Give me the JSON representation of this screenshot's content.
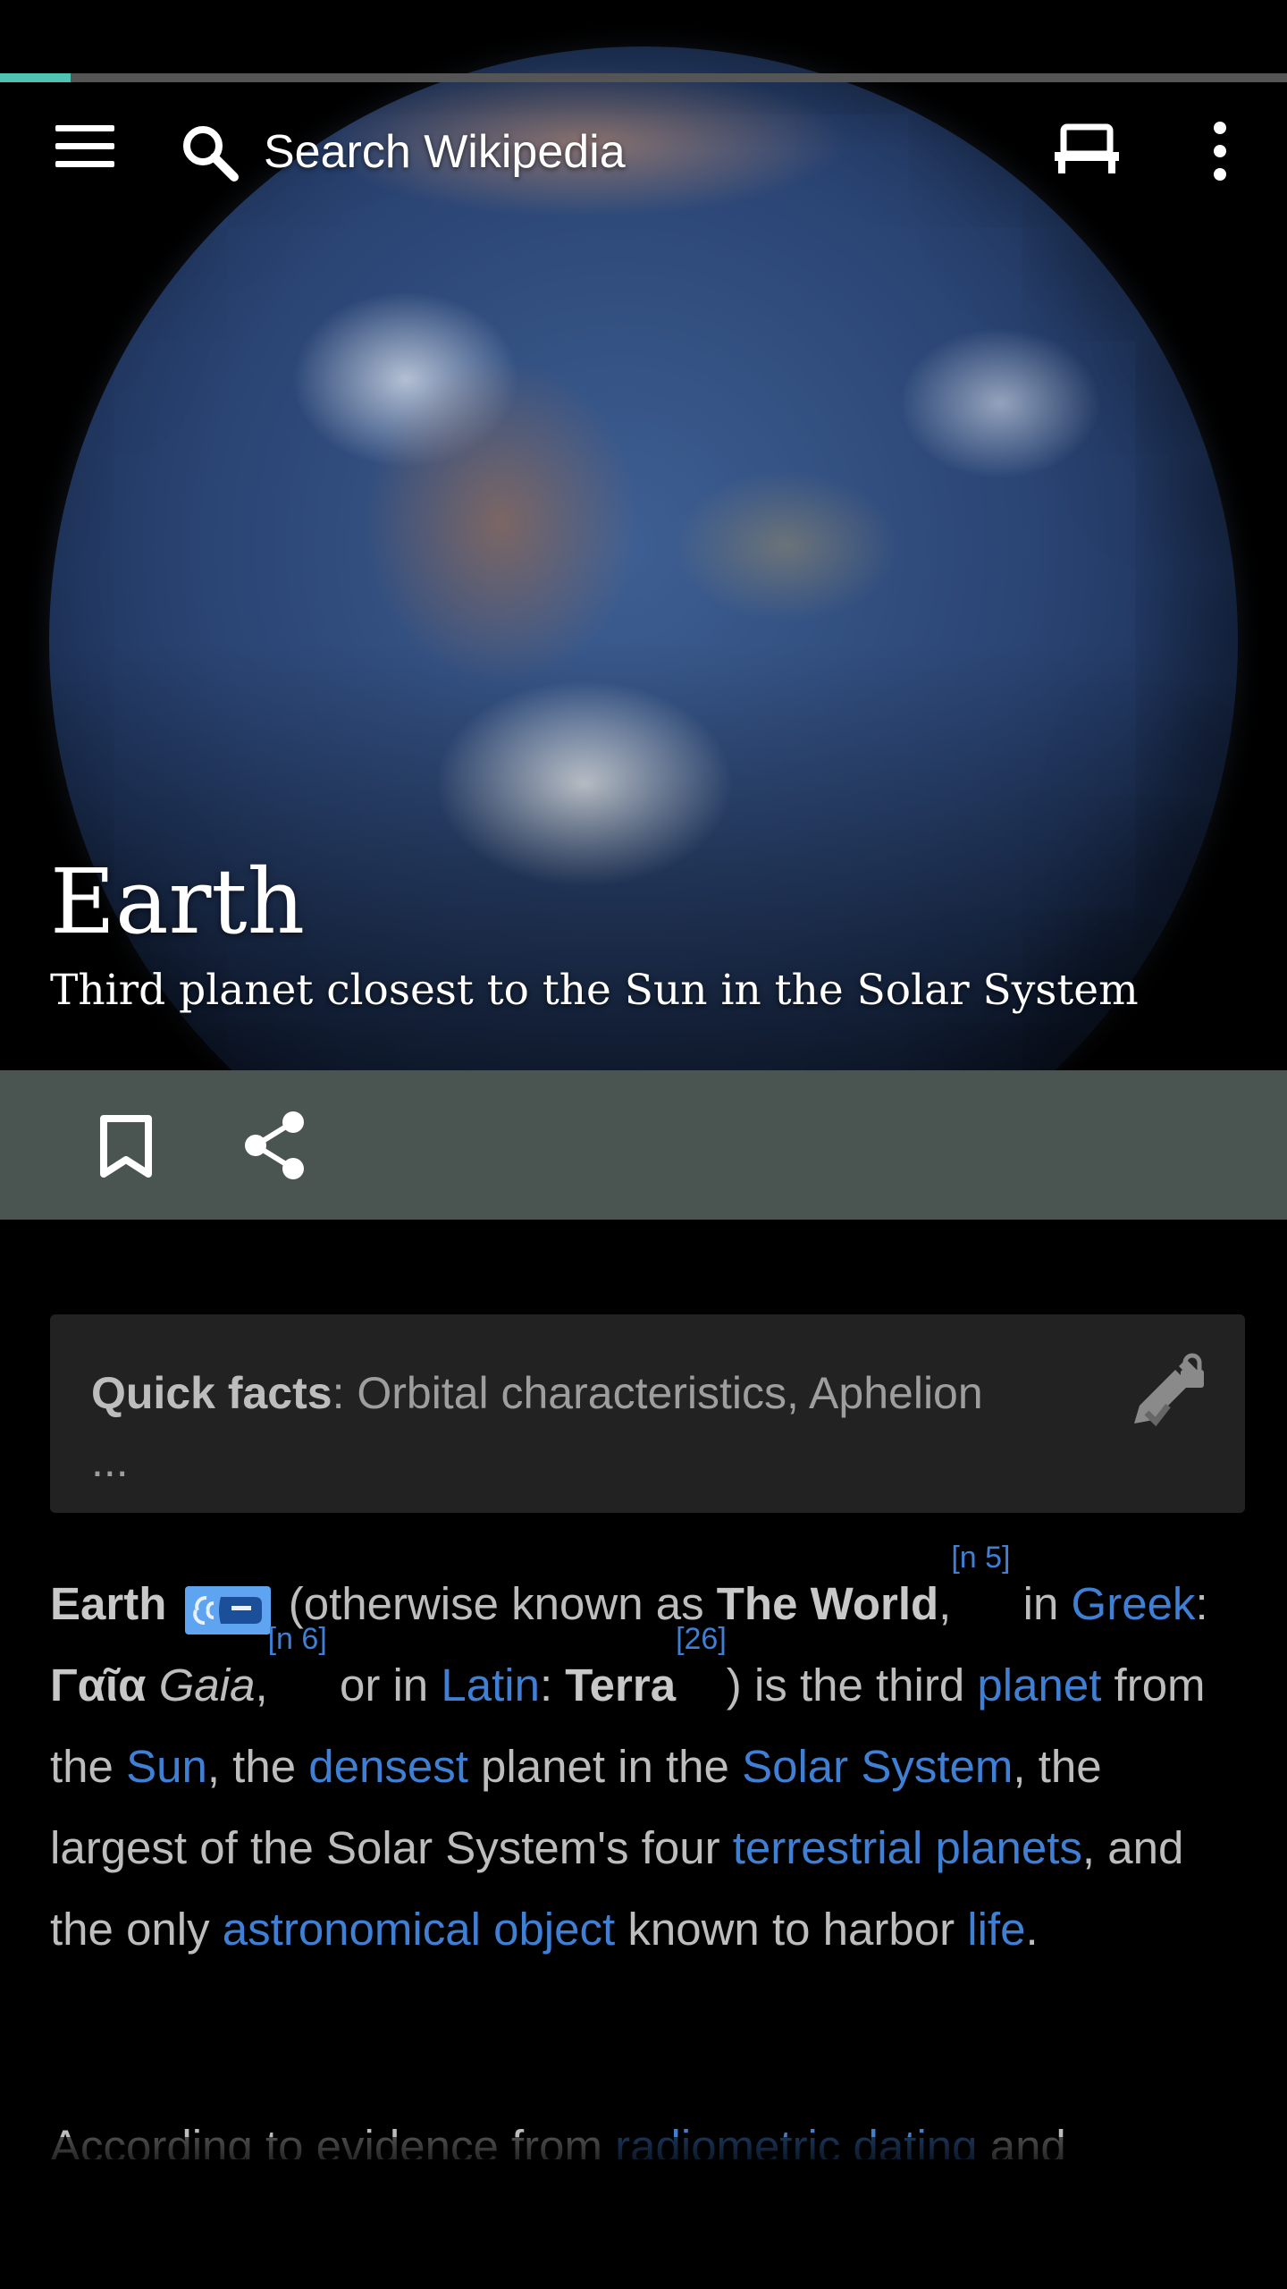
{
  "toolbar": {
    "search_placeholder": "Search Wikipedia",
    "load_progress": 0.055
  },
  "hero": {
    "title": "Earth",
    "subtitle": "Third planet closest to the Sun in the Solar System"
  },
  "quick_facts": {
    "label": "Quick facts",
    "text": ": Orbital characteristics, Aphelion",
    "ellipsis": "..."
  },
  "article": {
    "p1": {
      "t_earth": "Earth",
      "t1": " (otherwise known as ",
      "t_world": "The World",
      "t2": ",",
      "ref1": "[n 5]",
      "t3": " in ",
      "l_greek": "Greek",
      "t4": ": ",
      "t_gaia_gr": "Γαῖα",
      "t5": " ",
      "t_gaia": "Gaia",
      "t6": ",",
      "ref2": "[n 6]",
      "t7": " or in ",
      "l_latin": "Latin",
      "t8": ": ",
      "t_terra": "Terra",
      "ref3": "[26]",
      "t9": ") is the third ",
      "l_planet": "planet",
      "t10": " from the ",
      "l_sun": "Sun",
      "t11": ", the ",
      "l_densest": "densest",
      "t12": " planet in the ",
      "l_solar_system": "Solar System",
      "t13": ", the largest of the Solar System's four ",
      "l_terrestrial": "terrestrial planets",
      "t14": ", and the only ",
      "l_astro": "astronomical object",
      "t15": " known to harbor ",
      "l_life": "life",
      "t16": "."
    },
    "p2": {
      "t1": "According to evidence from ",
      "l_radiometric": "radiometric dating",
      "t2": " and"
    }
  },
  "colors": {
    "link": "#3f7fd4",
    "progress": "#4fc3b4",
    "actions_bar": "#4a5451"
  },
  "icons": [
    "menu-icon",
    "search-icon",
    "reading-list-icon",
    "more-options-icon",
    "bookmark-icon",
    "share-icon",
    "edit-lock-icon",
    "audio-icon"
  ]
}
